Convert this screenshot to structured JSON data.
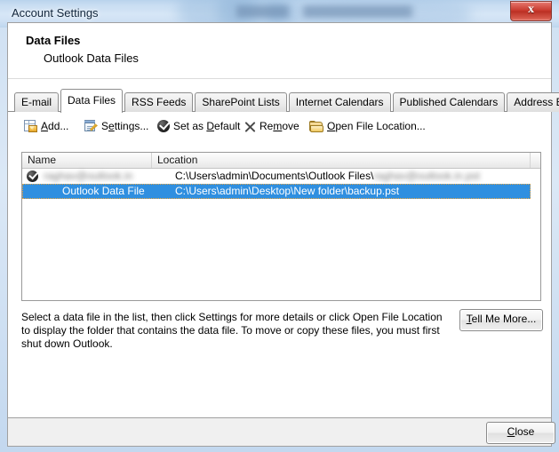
{
  "window": {
    "title": "Account Settings",
    "close_glyph": "x",
    "background_blurred": true
  },
  "header": {
    "title": "Data Files",
    "subtitle": "Outlook Data Files"
  },
  "tabs": [
    {
      "label": "E-mail",
      "active": false
    },
    {
      "label": "Data Files",
      "active": true
    },
    {
      "label": "RSS Feeds",
      "active": false
    },
    {
      "label": "SharePoint Lists",
      "active": false
    },
    {
      "label": "Internet Calendars",
      "active": false
    },
    {
      "label": "Published Calendars",
      "active": false
    },
    {
      "label": "Address Books",
      "active": false
    }
  ],
  "toolbar": {
    "add": {
      "label_pre": "",
      "accel": "A",
      "label_post": "dd...",
      "icon": "add-mail-icon"
    },
    "settings": {
      "label_pre": "S",
      "accel": "e",
      "label_post": "ttings...",
      "icon": "settings-icon"
    },
    "default": {
      "label_pre": "Set as ",
      "accel": "D",
      "label_post": "efault",
      "icon": "check-circle-icon"
    },
    "remove": {
      "label_pre": "Re",
      "accel": "m",
      "label_post": "ove",
      "icon": "x-icon"
    },
    "openloc": {
      "label_pre": "",
      "accel": "O",
      "label_post": "pen File Location...",
      "icon": "folder-icon"
    }
  },
  "list": {
    "columns": [
      "Name",
      "Location"
    ],
    "rows": [
      {
        "name": "raghav@outlook.in",
        "name_redacted": true,
        "location_prefix": "C:\\Users\\admin\\Documents\\Outlook Files\\",
        "location_redacted_part": "raghav@outlook.in",
        "location_suffix": ".pst",
        "is_default": true,
        "selected": false
      },
      {
        "name": "Outlook Data File",
        "name_redacted": false,
        "location_prefix": "C:\\Users\\admin\\Desktop\\New folder\\backup.pst",
        "location_redacted_part": "",
        "location_suffix": "",
        "is_default": false,
        "selected": true
      }
    ]
  },
  "description": "Select a data file in the list, then click Settings for more details or click Open File Location to display the folder that contains the data file. To move or copy these files, you must first shut down Outlook.",
  "buttons": {
    "tell_me_more": {
      "accel": "T",
      "label_post": "ell Me More..."
    },
    "close": {
      "accel": "C",
      "label_post": "lose"
    }
  },
  "colors": {
    "selection_blue": "#2f8fe0",
    "focus_orange": "#f0a63c",
    "close_red": "#c7382c",
    "glass_blue": "#cfe1f4"
  }
}
